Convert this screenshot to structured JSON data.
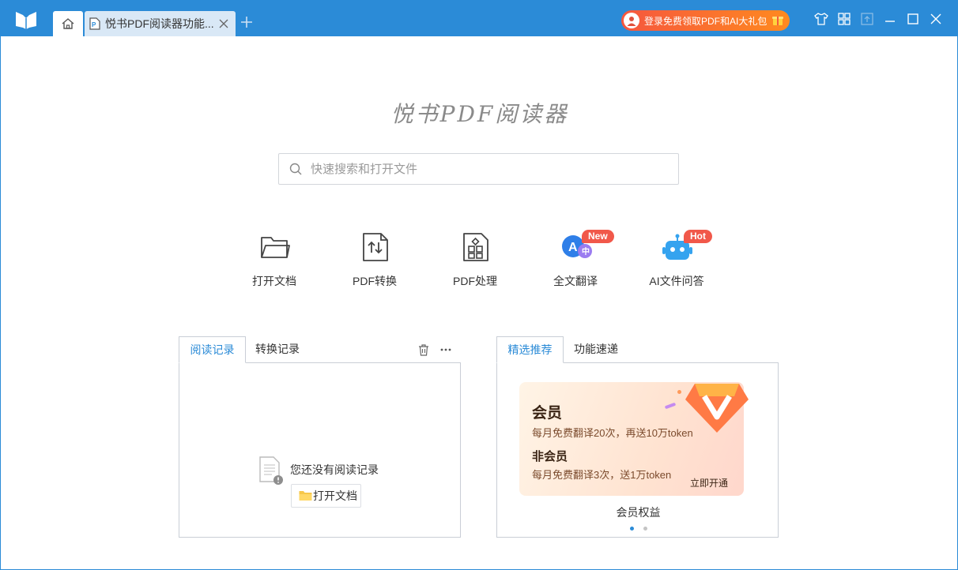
{
  "titlebar": {
    "tabs": [
      {
        "label": "悦书PDF阅读器功能..."
      }
    ],
    "promo": {
      "text": "登录免费领取PDF和AI大礼包"
    }
  },
  "main": {
    "brand": "悦书PDF阅读器",
    "search": {
      "placeholder": "快速搜索和打开文件"
    },
    "tools": [
      {
        "label": "打开文档",
        "icon": "folder-icon"
      },
      {
        "label": "PDF转换",
        "icon": "convert-icon"
      },
      {
        "label": "PDF处理",
        "icon": "process-icon"
      },
      {
        "label": "全文翻译",
        "icon": "translate-icon",
        "badge": "New"
      },
      {
        "label": "AI文件问答",
        "icon": "robot-icon",
        "badge": "Hot"
      }
    ]
  },
  "history": {
    "tabs": [
      {
        "label": "阅读记录"
      },
      {
        "label": "转换记录"
      }
    ],
    "empty_text": "您还没有阅读记录",
    "open_button": "打开文档"
  },
  "recommend": {
    "tabs": [
      {
        "label": "精选推荐"
      },
      {
        "label": "功能速递"
      }
    ],
    "banner": {
      "title": "会员",
      "line1": "每月免费翻译20次，再送10万token",
      "title2": "非会员",
      "line2": "每月免费翻译3次，送1万token",
      "cta": "立即开通"
    },
    "caption": "会员权益",
    "carousel": {
      "count": 2,
      "active": 1
    }
  },
  "colors": {
    "accent": "#2b8bd7",
    "promo": "#f5573f",
    "badge": "#f1584a"
  }
}
